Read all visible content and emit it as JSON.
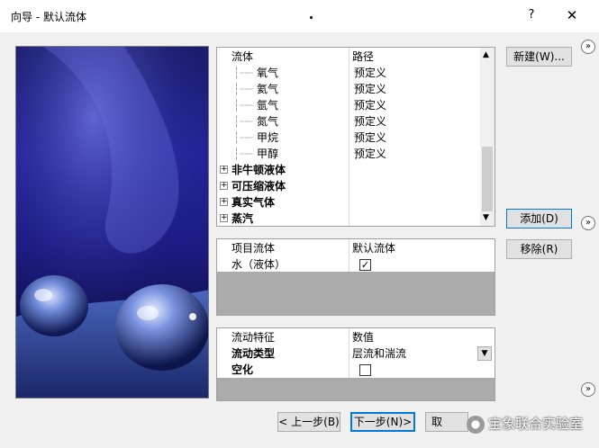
{
  "window": {
    "title": "向导 - 默认流体",
    "help": "?",
    "close": "✕"
  },
  "fluids": {
    "header": {
      "col1": "流体",
      "col2": "路径"
    },
    "gas_rows": [
      {
        "name": "氧气",
        "path": "预定义"
      },
      {
        "name": "氦气",
        "path": "预定义"
      },
      {
        "name": "氩气",
        "path": "预定义"
      },
      {
        "name": "氮气",
        "path": "预定义"
      },
      {
        "name": "甲烷",
        "path": "预定义"
      },
      {
        "name": "甲醇",
        "path": "预定义"
      }
    ],
    "groups": [
      {
        "label": "非牛顿液体"
      },
      {
        "label": "可压缩液体"
      },
      {
        "label": "真实气体"
      },
      {
        "label": "蒸汽"
      }
    ],
    "expand_symbol": "+"
  },
  "project_fluids": {
    "header": {
      "col1": "项目流体",
      "col2": "默认流体"
    },
    "rows": [
      {
        "name": "水（液体）",
        "default": true
      }
    ]
  },
  "flow": {
    "header": {
      "col1": "流动特征",
      "col2": "数值"
    },
    "rows": [
      {
        "name": "流动类型",
        "value": "层流和湍流"
      },
      {
        "name": "空化",
        "checked": false
      }
    ]
  },
  "buttons": {
    "new": "新建(W)...",
    "add": "添加(D)",
    "remove": "移除(R)",
    "prev": "< 上一步(B)",
    "next": "下一步(N)>",
    "cancel": "取"
  },
  "watermark": "宝象联合实验室",
  "expand_chevron": "»"
}
